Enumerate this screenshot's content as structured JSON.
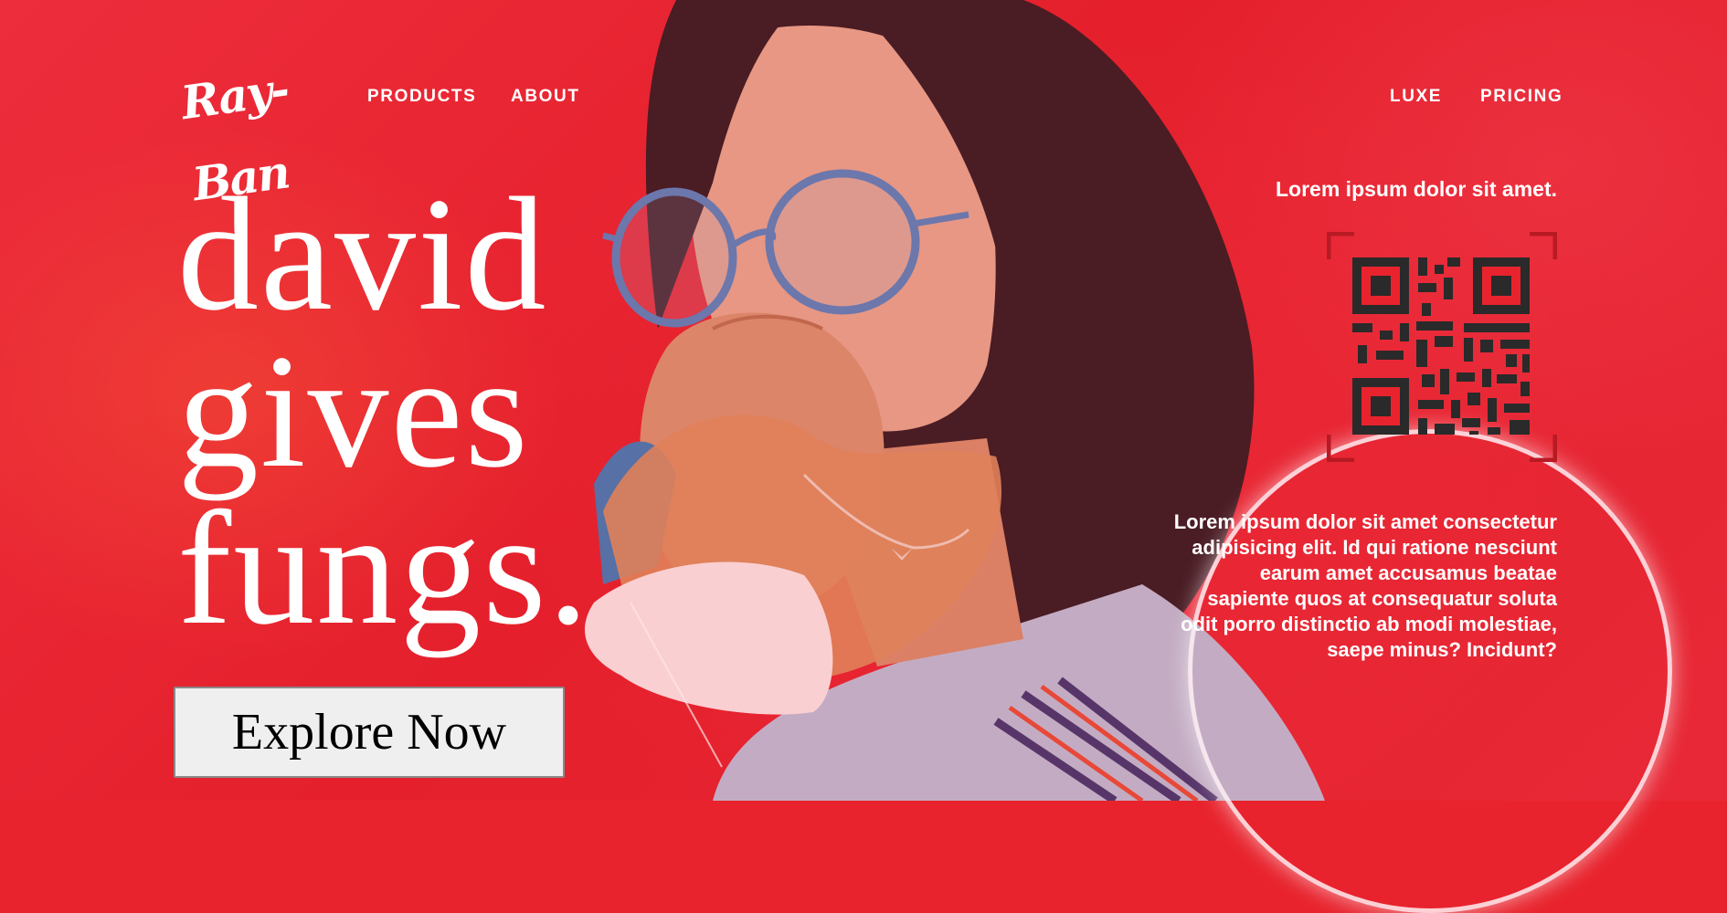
{
  "brand": {
    "logo_text": "Ray-Ban"
  },
  "nav": {
    "products": "PRODUCTS",
    "about": "ABOUT",
    "luxe": "LUXE",
    "pricing": "PRICING"
  },
  "hero": {
    "headline_lines": [
      "david",
      "gives",
      "fungs."
    ],
    "cta_label": "Explore Now",
    "tagline": "Lorem ipsum dolor sit amet.",
    "blurb": "Lorem ipsum dolor sit amet consectetur adipisicing elit. Id qui ratione nesciunt earum amet accusamus beatae sapiente quos at consequatur soluta odit porro distinctio ab modi molestiae, saepe minus? Incidunt?"
  },
  "colors": {
    "background": "#e8232d",
    "text": "#ffffff",
    "button_bg": "#efefef",
    "qr": "#2a2a2a"
  },
  "icons": {
    "qr_code": "qr-code-icon"
  }
}
